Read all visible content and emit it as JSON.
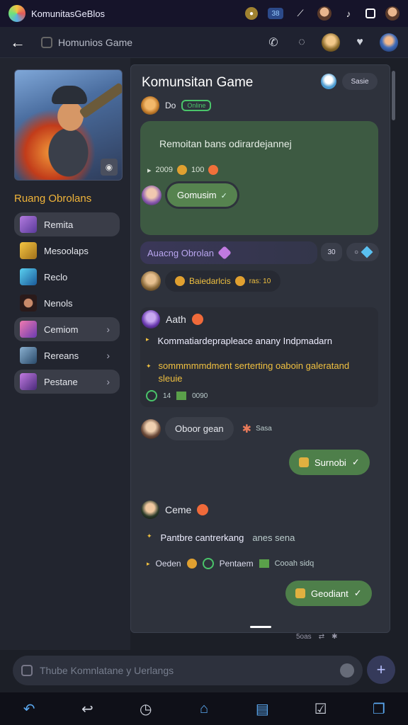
{
  "status": {
    "app_title": "KomunitasGeBlos",
    "pill_text": "38"
  },
  "header": {
    "channel_title": "Homunios Game"
  },
  "sidebar": {
    "heading": "Ruang Obrolans",
    "items": [
      {
        "label": "Remita"
      },
      {
        "label": "Mesoolaps"
      },
      {
        "label": "Reclo"
      },
      {
        "label": "Nenols"
      },
      {
        "label": "Cemiom"
      },
      {
        "label": "Rereans"
      },
      {
        "label": "Pestane"
      }
    ]
  },
  "chat": {
    "title": "Komunsitan Game",
    "head_button": "Sasie",
    "sub_label": "Do",
    "online_label": "Online",
    "green_text": "Remoitan bans odirardejannej",
    "green_meta1": "2009",
    "green_meta2": "100",
    "green_reply": "Gomusim",
    "purple_label": "Auacng Obrolan",
    "num_chip": "30",
    "badge_text": "Baiedarlcis",
    "badge_small": "ras: 10",
    "card_author": "Aath",
    "card_line1": "Kommatiardeprapleace anany Indpmadarn",
    "card_line2": "sommmmmdment serterting oaboin galeratand sleuie",
    "card_meta1": "14",
    "card_meta2": "0090",
    "oboor_text": "Oboor gean",
    "oboor_small": "Sasa",
    "sent1": "Surnobi",
    "came_author": "Ceme",
    "pant_text": "Pantbre cantrerkang",
    "pant_tail": "anes sena",
    "oed_text": "Oeden",
    "oed_label": "Pentaem",
    "oed_small": "Cooah sidq",
    "sent2": "Geodiant",
    "bottom_meta": "5oas"
  },
  "composer": {
    "placeholder": "Thube Komnlatane y Uerlangs"
  }
}
